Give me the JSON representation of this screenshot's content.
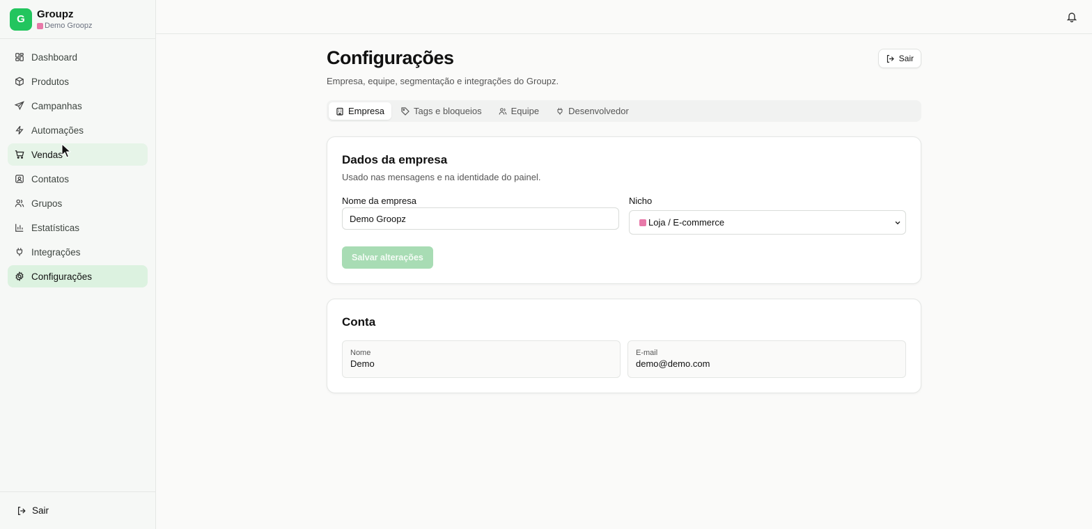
{
  "app": {
    "name": "Groupz",
    "workspace": "Demo Groopz",
    "logo_letter": "G",
    "accent": "#22c55e"
  },
  "sidebar": {
    "items": [
      {
        "label": "Dashboard",
        "icon": "dashboard-icon"
      },
      {
        "label": "Produtos",
        "icon": "box-icon"
      },
      {
        "label": "Campanhas",
        "icon": "send-icon"
      },
      {
        "label": "Automações",
        "icon": "bolt-icon"
      },
      {
        "label": "Vendas",
        "icon": "cart-icon"
      },
      {
        "label": "Contatos",
        "icon": "contact-icon"
      },
      {
        "label": "Grupos",
        "icon": "users-icon"
      },
      {
        "label": "Estatísticas",
        "icon": "bar-chart-icon"
      },
      {
        "label": "Integrações",
        "icon": "plug-icon"
      },
      {
        "label": "Configurações",
        "icon": "gear-icon"
      }
    ],
    "active": "Configurações",
    "hovered": "Vendas",
    "footer_label": "Sair"
  },
  "header": {
    "title": "Configurações",
    "subtitle": "Empresa, equipe, segmentação e integrações do Groupz.",
    "exit_label": "Sair"
  },
  "tabs": [
    {
      "label": "Empresa",
      "icon": "building-icon",
      "active": true
    },
    {
      "label": "Tags e bloqueios",
      "icon": "tag-icon",
      "active": false
    },
    {
      "label": "Equipe",
      "icon": "users-icon",
      "active": false
    },
    {
      "label": "Desenvolvedor",
      "icon": "plug-icon",
      "active": false
    }
  ],
  "company": {
    "title": "Dados da empresa",
    "description": "Usado nas mensagens e na identidade do painel.",
    "name_label": "Nome da empresa",
    "name_value": "Demo Groopz",
    "niche_label": "Nicho",
    "niche_value": "Loja / E-commerce",
    "save_label": "Salvar alterações"
  },
  "account": {
    "title": "Conta",
    "name_label": "Nome",
    "name_value": "Demo",
    "email_label": "E-mail",
    "email_value": "demo@demo.com"
  }
}
